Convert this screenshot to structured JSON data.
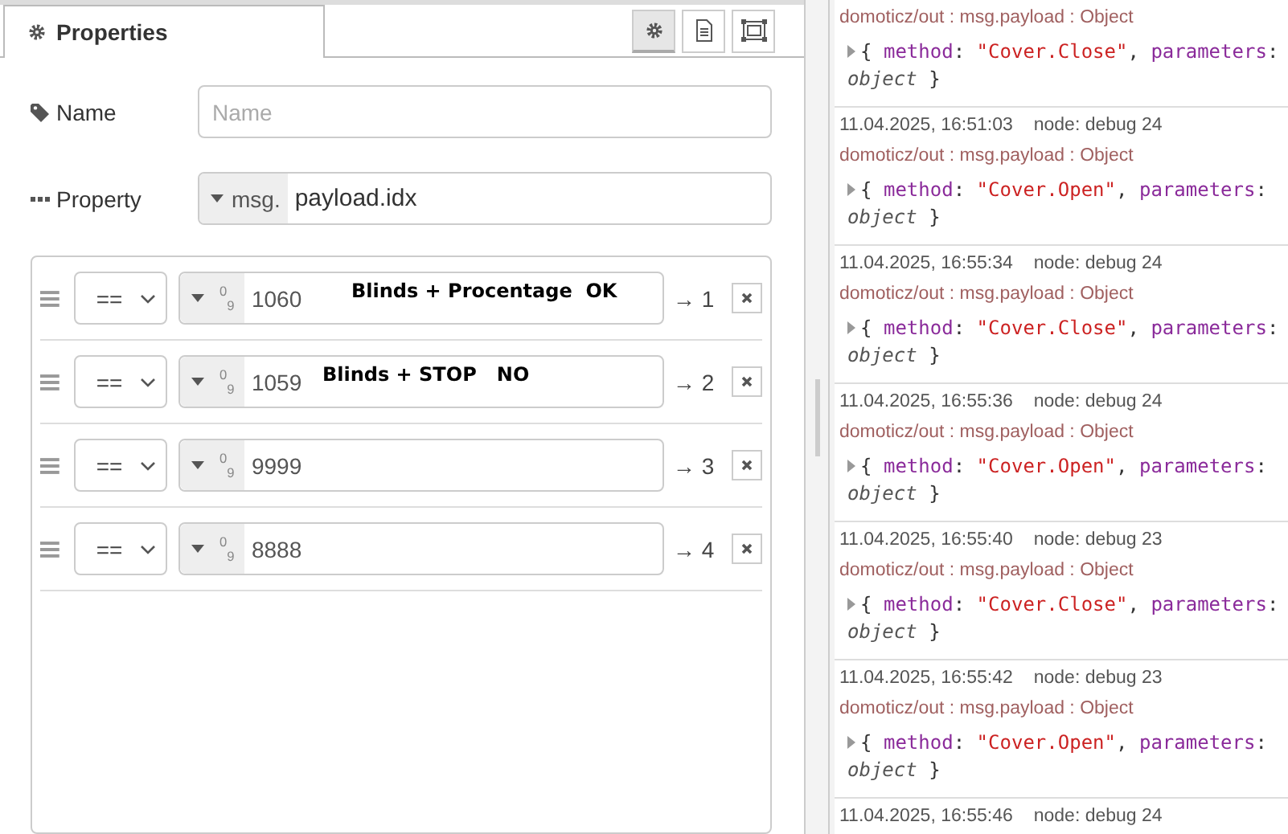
{
  "editor": {
    "tab": {
      "label": "Properties",
      "selected": true
    },
    "toolbar": [
      {
        "kind": "gear",
        "selected": true
      },
      {
        "kind": "document",
        "selected": false
      },
      {
        "kind": "frame",
        "selected": false
      }
    ],
    "name_field": {
      "label": "Name",
      "placeholder": "Name"
    },
    "property_field": {
      "label": "Property",
      "prefix": "msg.",
      "value": "payload.idx"
    },
    "rules": [
      {
        "operator": "==",
        "type": "$^{0}$$_{9}$",
        "value": "1060",
        "note": "Blinds + Procentage  OK",
        "output": "→ 1"
      },
      {
        "operator": "==",
        "type": "$^{0}$$_{9}$",
        "value": "1059",
        "note": "Blinds + STOP   NO",
        "output": "→ 2"
      },
      {
        "operator": "==",
        "type": "$^{0}$$_{9}$",
        "value": "9999",
        "output": "→ 3"
      },
      {
        "operator": "==",
        "type": "$^{0}$$_{9}$",
        "value": "8888",
        "output": "→ 4"
      }
    ]
  },
  "debug": {
    "messages": [
      {
        "topic": "domoticz/out : msg.payload : Object",
        "payload": [
          {
            "kind": "punct",
            "text": "{"
          },
          {
            "kind": "key",
            "text": "method"
          },
          {
            "kind": "punct",
            "text": ":"
          },
          {
            "kind": "string",
            "text": "\"Cover.Close\""
          },
          {
            "kind": "punct",
            "text": ","
          },
          {
            "kind": "key",
            "text": "parameters"
          },
          {
            "kind": "punct",
            "text": ":"
          },
          {
            "kind": "type",
            "text": "object"
          },
          {
            "kind": "punct",
            "text": "}"
          }
        ]
      },
      {
        "time": "11.04.2025, 16:51:03",
        "node": "node: debug 24",
        "topic": "domoticz/out : msg.payload : Object",
        "payload": [
          {
            "kind": "punct",
            "text": "{"
          },
          {
            "kind": "key",
            "text": "method"
          },
          {
            "kind": "punct",
            "text": ":"
          },
          {
            "kind": "string",
            "text": "\"Cover.Open\""
          },
          {
            "kind": "punct",
            "text": ","
          },
          {
            "kind": "key",
            "text": "parameters"
          },
          {
            "kind": "punct",
            "text": ":"
          },
          {
            "kind": "type",
            "text": "object"
          },
          {
            "kind": "punct",
            "text": "}"
          }
        ]
      },
      {
        "time": "11.04.2025, 16:55:34",
        "node": "node: debug 24",
        "topic": "domoticz/out : msg.payload : Object",
        "payload": [
          {
            "kind": "punct",
            "text": "{"
          },
          {
            "kind": "key",
            "text": "method"
          },
          {
            "kind": "punct",
            "text": ":"
          },
          {
            "kind": "string",
            "text": "\"Cover.Close\""
          },
          {
            "kind": "punct",
            "text": ","
          },
          {
            "kind": "key",
            "text": "parameters"
          },
          {
            "kind": "punct",
            "text": ":"
          },
          {
            "kind": "type",
            "text": "object"
          },
          {
            "kind": "punct",
            "text": "}"
          }
        ]
      },
      {
        "time": "11.04.2025, 16:55:36",
        "node": "node: debug 24",
        "topic": "domoticz/out : msg.payload : Object",
        "payload": [
          {
            "kind": "punct",
            "text": "{"
          },
          {
            "kind": "key",
            "text": "method"
          },
          {
            "kind": "punct",
            "text": ":"
          },
          {
            "kind": "string",
            "text": "\"Cover.Open\""
          },
          {
            "kind": "punct",
            "text": ","
          },
          {
            "kind": "key",
            "text": "parameters"
          },
          {
            "kind": "punct",
            "text": ":"
          },
          {
            "kind": "type",
            "text": "object"
          },
          {
            "kind": "punct",
            "text": "}"
          }
        ]
      },
      {
        "time": "11.04.2025, 16:55:40",
        "node": "node: debug 23",
        "topic": "domoticz/out : msg.payload : Object",
        "payload": [
          {
            "kind": "punct",
            "text": "{"
          },
          {
            "kind": "key",
            "text": "method"
          },
          {
            "kind": "punct",
            "text": ":"
          },
          {
            "kind": "string",
            "text": "\"Cover.Close\""
          },
          {
            "kind": "punct",
            "text": ","
          },
          {
            "kind": "key",
            "text": "parameters"
          },
          {
            "kind": "punct",
            "text": ":"
          },
          {
            "kind": "type",
            "text": "object"
          },
          {
            "kind": "punct",
            "text": "}"
          }
        ]
      },
      {
        "time": "11.04.2025, 16:55:42",
        "node": "node: debug 23",
        "topic": "domoticz/out : msg.payload : Object",
        "payload": [
          {
            "kind": "punct",
            "text": "{"
          },
          {
            "kind": "key",
            "text": "method"
          },
          {
            "kind": "punct",
            "text": ":"
          },
          {
            "kind": "string",
            "text": "\"Cover.Open\""
          },
          {
            "kind": "punct",
            "text": ","
          },
          {
            "kind": "key",
            "text": "parameters"
          },
          {
            "kind": "punct",
            "text": ":"
          },
          {
            "kind": "type",
            "text": "object"
          },
          {
            "kind": "punct",
            "text": "}"
          }
        ]
      },
      {
        "time": "11.04.2025, 16:55:46",
        "node": "node: debug 24"
      }
    ]
  }
}
